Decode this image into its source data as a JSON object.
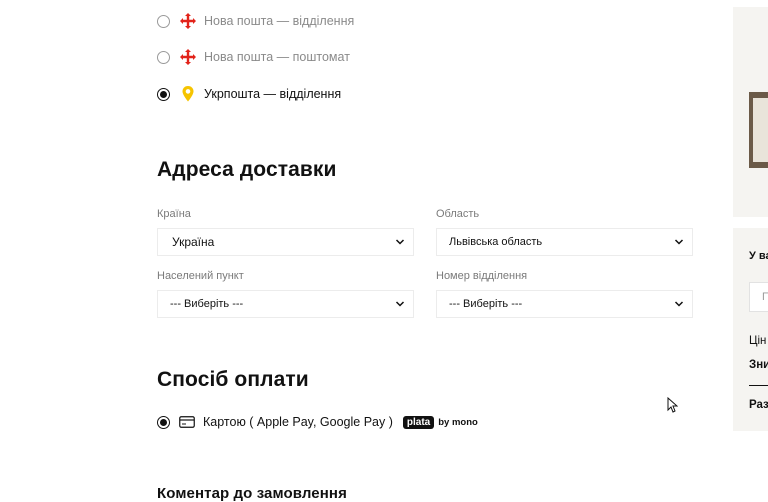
{
  "delivery_methods": [
    {
      "label": "Нова пошта — відділення",
      "selected": false,
      "icon": "nova-poshta-icon"
    },
    {
      "label": "Нова пошта — поштомат",
      "selected": false,
      "icon": "nova-poshta-icon"
    },
    {
      "label": "Укрпошта — відділення",
      "selected": true,
      "icon": "ukrposhta-icon"
    }
  ],
  "address": {
    "title": "Адреса доставки",
    "country": {
      "label": "Країна",
      "value": "Україна"
    },
    "region": {
      "label": "Область",
      "value": "Львівська область"
    },
    "city": {
      "label": "Населений пункт",
      "value": "--- Виберіть ---"
    },
    "branch": {
      "label": "Номер відділення",
      "value": "--- Виберіть ---"
    }
  },
  "payment": {
    "title": "Спосіб оплати",
    "option_label": "Картою ( Apple Pay, Google Pay )",
    "badge_pill": "plata",
    "badge_by": "by mono"
  },
  "comment": {
    "title": "Коментар до замовлення"
  },
  "sidebar": {
    "promo_heading": "У ва",
    "promo_input_placeholder": "П",
    "price_label": "Цін",
    "discount_label": "Зни",
    "total_label": "Раз"
  },
  "colors": {
    "accent": "#111111",
    "nova_poshta_red": "#e2231a",
    "ukrposhta_yellow": "#f6c400",
    "sidebar_bg": "#f5f4f1"
  }
}
